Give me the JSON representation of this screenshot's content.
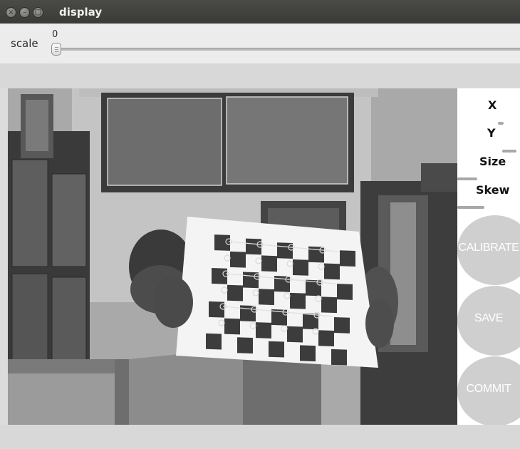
{
  "window": {
    "title": "display",
    "buttons": [
      {
        "name": "close",
        "glyph": "×"
      },
      {
        "name": "minimize",
        "glyph": "–"
      },
      {
        "name": "maximize",
        "glyph": "□"
      }
    ]
  },
  "trackbar": {
    "label": "scale",
    "value": "0",
    "level_fraction": 0.0
  },
  "side_panel": {
    "labels": [
      "X",
      "Y",
      "Size",
      "Skew"
    ],
    "buttons": [
      "CALIBRATE",
      "SAVE",
      "COMMIT"
    ]
  },
  "colors": {
    "titlebar": "#3e3e3b",
    "panel_background": "#ffffff",
    "button_fill": "#cfcfcf",
    "progress_bar": "#a8a8a8"
  },
  "camera_view": {
    "description_icon": "webcam-feed",
    "checkerboard": {
      "columns": 9,
      "rows": 6
    }
  }
}
